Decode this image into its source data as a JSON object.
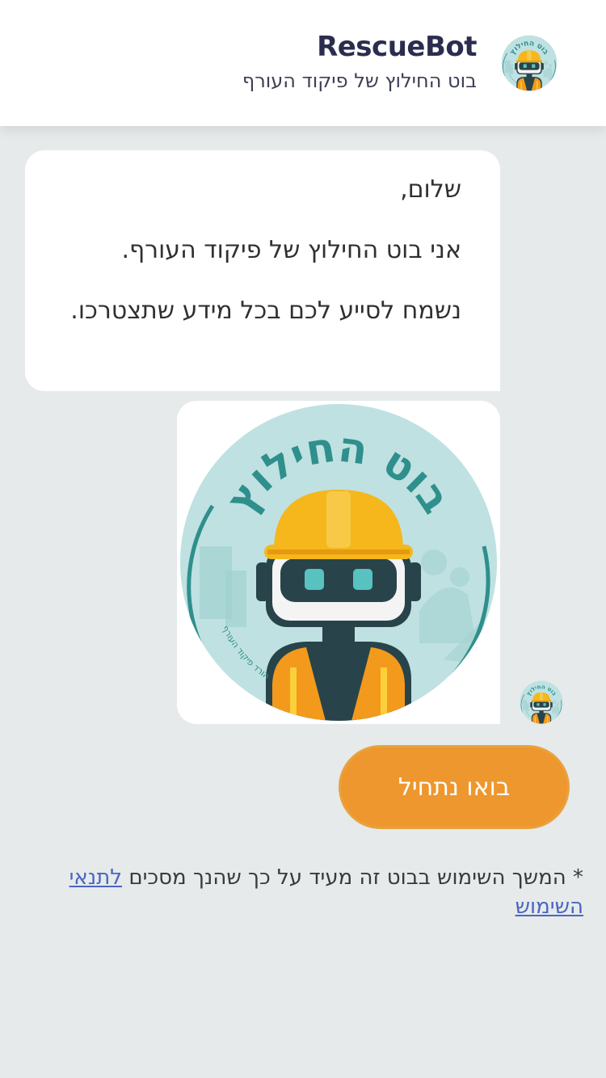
{
  "header": {
    "title": "RescueBot",
    "subtitle": "בוט החילוץ של פיקוד העורף"
  },
  "logo": {
    "text": "בוט החילוץ",
    "footer_text": "הורד פיקוד העורף",
    "colors": {
      "circle": "#bfe1e1",
      "arc": "#2f8f8c",
      "helmet": "#f5b71c",
      "vest": "#f39a1d",
      "robot_dark": "#28444a",
      "eyes": "#57c2c0"
    }
  },
  "message": {
    "lines": [
      "שלום,",
      "אני בוט החילוץ של פיקוד העורף.",
      "נשמח לסייע לכם בכל מידע שתצטרכו."
    ]
  },
  "start_button": {
    "label": "בואו נתחיל"
  },
  "terms": {
    "prefix": "* המשך השימוש בבוט זה מעיד על כך שהנך מסכים ",
    "link": "לתנאי השימוש"
  }
}
